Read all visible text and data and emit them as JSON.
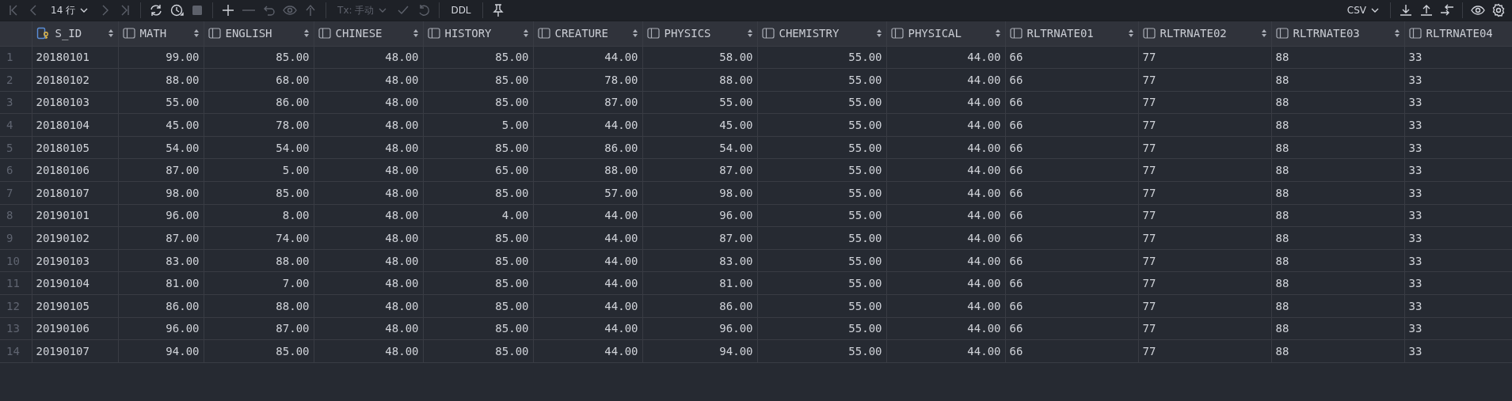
{
  "toolbar": {
    "left_groups": [
      [
        {
          "kind": "first",
          "disabled": true
        },
        {
          "kind": "prev",
          "disabled": true
        },
        {
          "kind": "dropdown",
          "label": "14 行",
          "disabled": false
        },
        {
          "kind": "next",
          "disabled": true
        },
        {
          "kind": "last",
          "disabled": true
        }
      ],
      [
        {
          "kind": "refresh",
          "disabled": false
        },
        {
          "kind": "history",
          "disabled": false
        },
        {
          "kind": "stop",
          "disabled": true
        }
      ],
      [
        {
          "kind": "add",
          "disabled": false
        },
        {
          "kind": "remove",
          "disabled": true
        },
        {
          "kind": "revert",
          "disabled": true
        },
        {
          "kind": "preview",
          "disabled": true
        },
        {
          "kind": "submit",
          "disabled": true
        }
      ],
      [
        {
          "kind": "dropdown",
          "label": "Tx: 手动",
          "disabled": true
        },
        {
          "kind": "commit",
          "disabled": true
        },
        {
          "kind": "rollback",
          "disabled": true
        }
      ],
      [
        {
          "kind": "text",
          "label": "DDL",
          "disabled": false
        }
      ],
      [
        {
          "kind": "pin",
          "disabled": false
        }
      ]
    ],
    "right_groups": [
      [
        {
          "kind": "dropdown",
          "label": "CSV",
          "disabled": false
        }
      ],
      [
        {
          "kind": "download",
          "disabled": false
        },
        {
          "kind": "upload",
          "disabled": false
        },
        {
          "kind": "compare",
          "disabled": false
        }
      ],
      [
        {
          "kind": "view",
          "disabled": false
        },
        {
          "kind": "settings",
          "disabled": false
        }
      ]
    ]
  },
  "table": {
    "columns": [
      {
        "name": "S_ID",
        "kind": "key",
        "sortable": true
      },
      {
        "name": "MATH",
        "kind": "decimal",
        "sortable": true
      },
      {
        "name": "ENGLISH",
        "kind": "decimal",
        "sortable": true
      },
      {
        "name": "CHINESE",
        "kind": "decimal",
        "sortable": true
      },
      {
        "name": "HISTORY",
        "kind": "decimal",
        "sortable": true
      },
      {
        "name": "CREATURE",
        "kind": "decimal",
        "sortable": true
      },
      {
        "name": "PHYSICS",
        "kind": "decimal",
        "sortable": true
      },
      {
        "name": "CHEMISTRY",
        "kind": "decimal",
        "sortable": true
      },
      {
        "name": "PHYSICAL",
        "kind": "decimal",
        "sortable": true
      },
      {
        "name": "RLTRNATE01",
        "kind": "integer",
        "sortable": true
      },
      {
        "name": "RLTRNATE02",
        "kind": "integer",
        "sortable": true
      },
      {
        "name": "RLTRNATE03",
        "kind": "integer",
        "sortable": true
      },
      {
        "name": "RLTRNATE04",
        "kind": "integer",
        "sortable": false
      }
    ],
    "rows": [
      {
        "number": "1",
        "cells": [
          "20180101",
          "99.00",
          "85.00",
          "48.00",
          "85.00",
          "44.00",
          "58.00",
          "55.00",
          "44.00",
          "66",
          "77",
          "88",
          "33"
        ]
      },
      {
        "number": "2",
        "cells": [
          "20180102",
          "88.00",
          "68.00",
          "48.00",
          "85.00",
          "78.00",
          "88.00",
          "55.00",
          "44.00",
          "66",
          "77",
          "88",
          "33"
        ]
      },
      {
        "number": "3",
        "cells": [
          "20180103",
          "55.00",
          "86.00",
          "48.00",
          "85.00",
          "87.00",
          "55.00",
          "55.00",
          "44.00",
          "66",
          "77",
          "88",
          "33"
        ]
      },
      {
        "number": "4",
        "cells": [
          "20180104",
          "45.00",
          "78.00",
          "48.00",
          "5.00",
          "44.00",
          "45.00",
          "55.00",
          "44.00",
          "66",
          "77",
          "88",
          "33"
        ]
      },
      {
        "number": "5",
        "cells": [
          "20180105",
          "54.00",
          "54.00",
          "48.00",
          "85.00",
          "86.00",
          "54.00",
          "55.00",
          "44.00",
          "66",
          "77",
          "88",
          "33"
        ]
      },
      {
        "number": "6",
        "cells": [
          "20180106",
          "87.00",
          "5.00",
          "48.00",
          "65.00",
          "88.00",
          "87.00",
          "55.00",
          "44.00",
          "66",
          "77",
          "88",
          "33"
        ]
      },
      {
        "number": "7",
        "cells": [
          "20180107",
          "98.00",
          "85.00",
          "48.00",
          "85.00",
          "57.00",
          "98.00",
          "55.00",
          "44.00",
          "66",
          "77",
          "88",
          "33"
        ]
      },
      {
        "number": "8",
        "cells": [
          "20190101",
          "96.00",
          "8.00",
          "48.00",
          "4.00",
          "44.00",
          "96.00",
          "55.00",
          "44.00",
          "66",
          "77",
          "88",
          "33"
        ]
      },
      {
        "number": "9",
        "cells": [
          "20190102",
          "87.00",
          "74.00",
          "48.00",
          "85.00",
          "44.00",
          "87.00",
          "55.00",
          "44.00",
          "66",
          "77",
          "88",
          "33"
        ]
      },
      {
        "number": "10",
        "cells": [
          "20190103",
          "83.00",
          "88.00",
          "48.00",
          "85.00",
          "44.00",
          "83.00",
          "55.00",
          "44.00",
          "66",
          "77",
          "88",
          "33"
        ]
      },
      {
        "number": "11",
        "cells": [
          "20190104",
          "81.00",
          "7.00",
          "48.00",
          "85.00",
          "44.00",
          "81.00",
          "55.00",
          "44.00",
          "66",
          "77",
          "88",
          "33"
        ]
      },
      {
        "number": "12",
        "cells": [
          "20190105",
          "86.00",
          "88.00",
          "48.00",
          "85.00",
          "44.00",
          "86.00",
          "55.00",
          "44.00",
          "66",
          "77",
          "88",
          "33"
        ]
      },
      {
        "number": "13",
        "cells": [
          "20190106",
          "96.00",
          "87.00",
          "48.00",
          "85.00",
          "44.00",
          "96.00",
          "55.00",
          "44.00",
          "66",
          "77",
          "88",
          "33"
        ]
      },
      {
        "number": "14",
        "cells": [
          "20190107",
          "94.00",
          "85.00",
          "48.00",
          "85.00",
          "44.00",
          "94.00",
          "55.00",
          "44.00",
          "66",
          "77",
          "88",
          "33"
        ]
      }
    ]
  }
}
